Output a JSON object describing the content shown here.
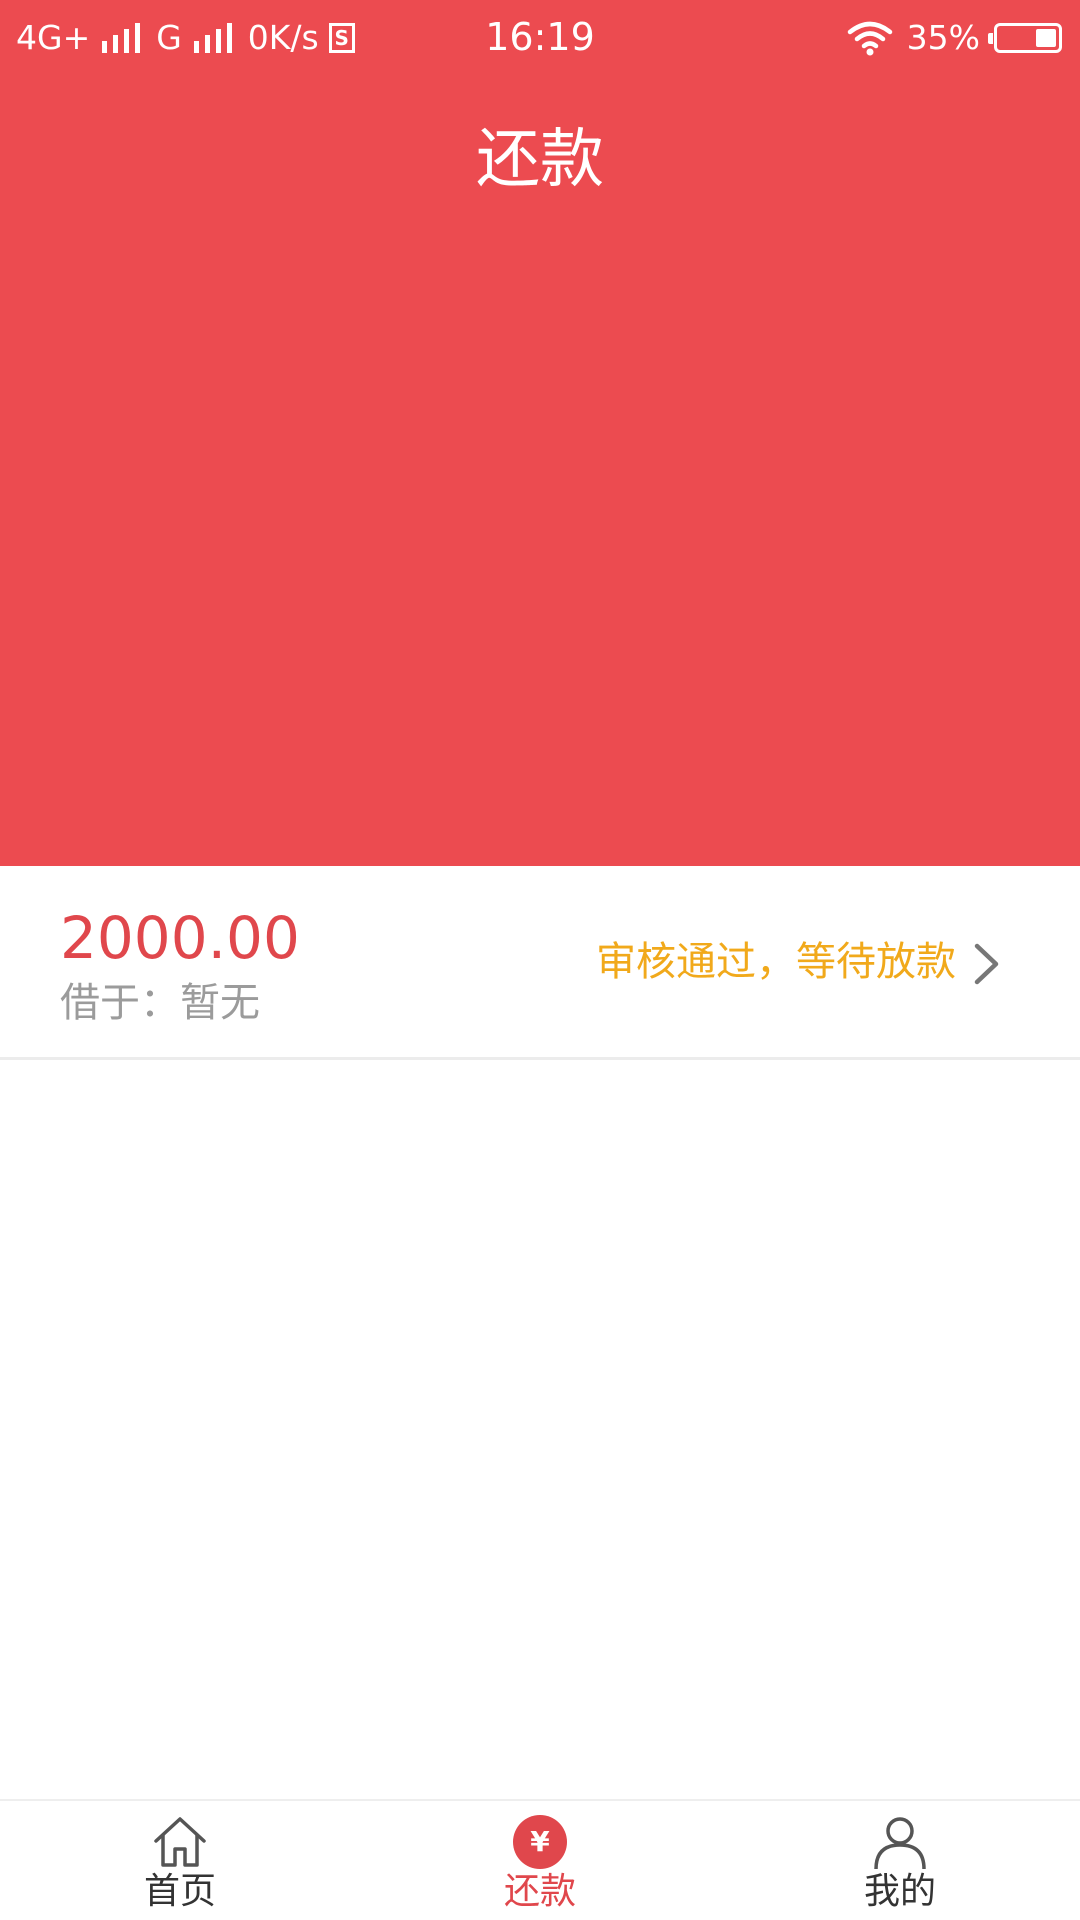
{
  "status_bar": {
    "network_1": "4G+",
    "network_2": "G",
    "speed": "0K/s",
    "sim_badge": "S",
    "time": "16:19",
    "battery_percent_text": "35%",
    "battery_level": 0.35
  },
  "header": {
    "title": "还款"
  },
  "loan": {
    "amount": "2000.00",
    "borrowed_label": "借于：",
    "borrowed_value": "暂无",
    "status": "审核通过，等待放款"
  },
  "bottom_nav": {
    "items": [
      {
        "label": "首页",
        "icon": "home-icon",
        "active": false
      },
      {
        "label": "还款",
        "icon": "yen-icon",
        "active": true
      },
      {
        "label": "我的",
        "icon": "user-icon",
        "active": false
      }
    ],
    "yen_glyph": "¥"
  },
  "colors": {
    "brand_red": "#ec4b50",
    "amount_red": "#e0474c",
    "status_orange": "#f1a91b",
    "muted_gray": "#9b9b9b"
  }
}
